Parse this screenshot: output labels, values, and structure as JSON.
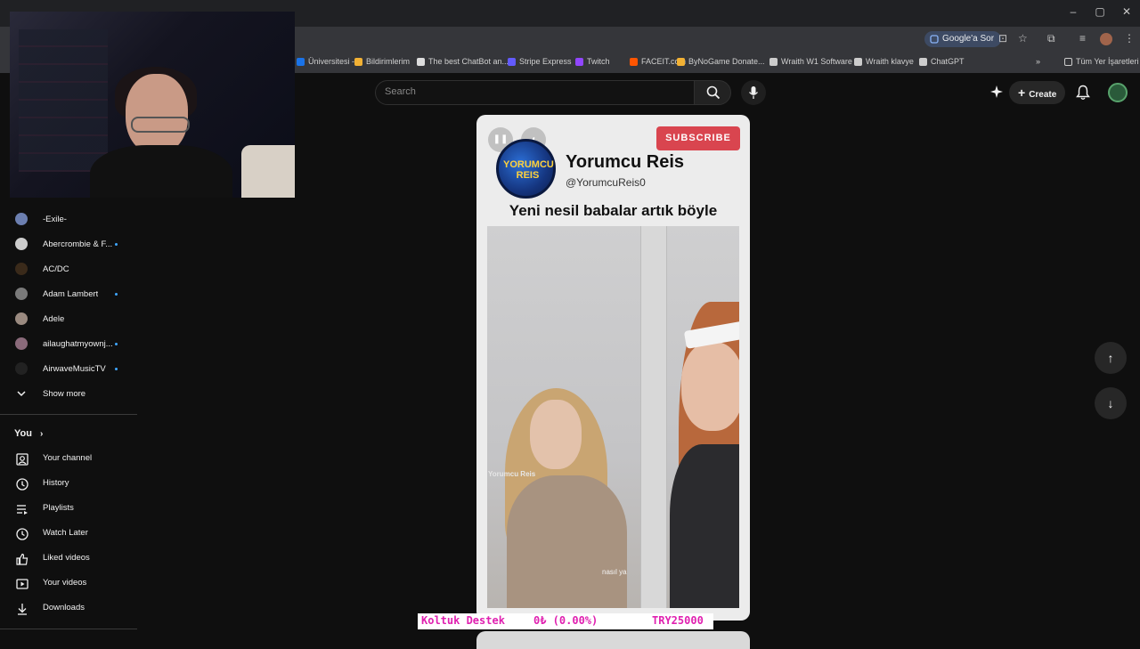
{
  "window": {
    "minimize": "–",
    "maximize": "▢",
    "close": "✕"
  },
  "toolbar": {
    "google_sor": "Google'a Sor"
  },
  "bookmarks": [
    {
      "label": "Üniversitesi -...",
      "color": "#1a73e8"
    },
    {
      "label": "Bildirimlerim",
      "color": "#f2b134"
    },
    {
      "label": "The best ChatBot an...",
      "color": "#dddddd"
    },
    {
      "label": "Stripe Express",
      "color": "#635bff"
    },
    {
      "label": "Twitch",
      "color": "#9146ff"
    },
    {
      "label": "FACEIT.com",
      "color": "#ff5500"
    },
    {
      "label": "ByNoGame Donate...",
      "color": "#f2b134"
    },
    {
      "label": "Wraith W1 Software",
      "color": "#cccccc"
    },
    {
      "label": "Wraith klavye",
      "color": "#cccccc"
    },
    {
      "label": "ChatGPT",
      "color": "#cccccc"
    }
  ],
  "bookmarks_overflow": "»",
  "all_bookmarks": "Tüm Yer İşaretleri",
  "header": {
    "search_placeholder": "Search",
    "create_label": "Create"
  },
  "subscriptions": [
    {
      "name": "-Exile-",
      "color": "#6c7fb0",
      "dot": false
    },
    {
      "name": "Abercrombie & F...",
      "color": "#cccccc",
      "dot": true
    },
    {
      "name": "AC/DC",
      "color": "#3a2a1a",
      "dot": false
    },
    {
      "name": "Adam Lambert",
      "color": "#7a7a7a",
      "dot": true
    },
    {
      "name": "Adele",
      "color": "#9a8a80",
      "dot": false
    },
    {
      "name": "ailaughatmyownj...",
      "color": "#8a6a7a",
      "dot": true
    },
    {
      "name": "AirwaveMusicTV",
      "color": "#222222",
      "dot": true
    }
  ],
  "show_more": "Show more",
  "you_section": {
    "title": "You",
    "items": [
      {
        "label": "Your channel"
      },
      {
        "label": "History"
      },
      {
        "label": "Playlists"
      },
      {
        "label": "Watch Later"
      },
      {
        "label": "Liked videos"
      },
      {
        "label": "Your videos"
      },
      {
        "label": "Downloads"
      }
    ]
  },
  "short": {
    "subscribe_label": "SUBSCRIBE",
    "logo_text": "YORUMCU REIS",
    "channel_name": "Yorumcu Reis",
    "channel_handle": "@YorumcuReis0",
    "caption": "Yeni nesil babalar artık böyle",
    "watermark": "Yorumcu Reis",
    "subtitle": "nasıl ya"
  },
  "nav_arrows": {
    "up": "↑",
    "down": "↓"
  },
  "donation": {
    "name": "Koltuk Destek",
    "amount": "0₺ (0.00%)",
    "goal": "TRY25000"
  }
}
